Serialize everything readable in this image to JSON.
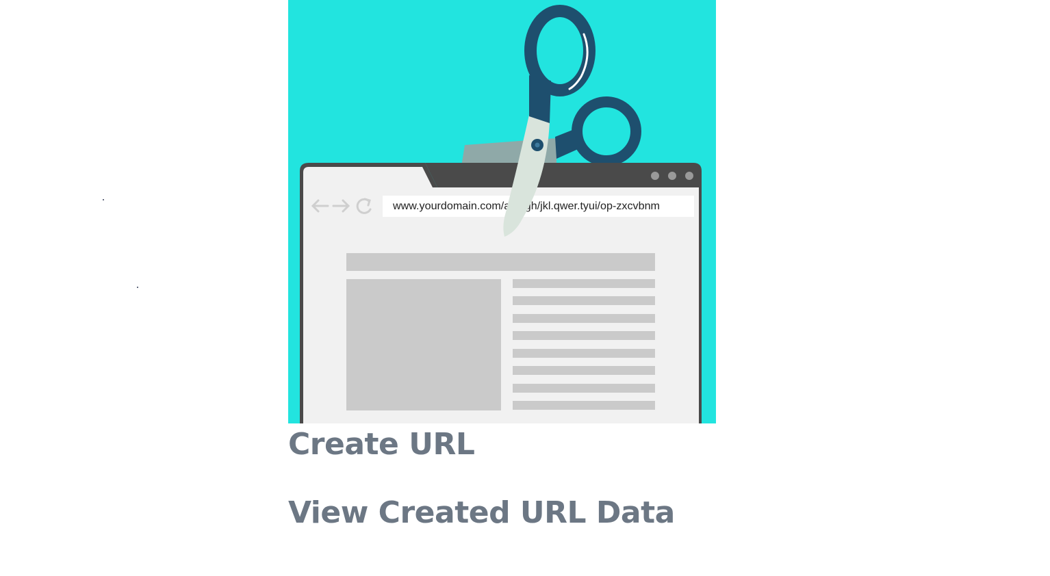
{
  "hero": {
    "url_bar_text": "www.yourdomain.com/asdfgh/jkl.qwer.tyui/op-zxcvbnm",
    "colors": {
      "background": "#22e4df",
      "browser_frame": "#4a4a4a",
      "page_background": "#f1f1f1",
      "placeholder_block": "#cacaca",
      "scissors_handle": "#1e4f6e",
      "scissors_blade": "#d9e4dc"
    }
  },
  "links": {
    "create_url": "Create URL",
    "view_created": "View Created URL Data"
  },
  "colors": {
    "link_text": "#6c7784",
    "page_background": "#ffffff"
  }
}
